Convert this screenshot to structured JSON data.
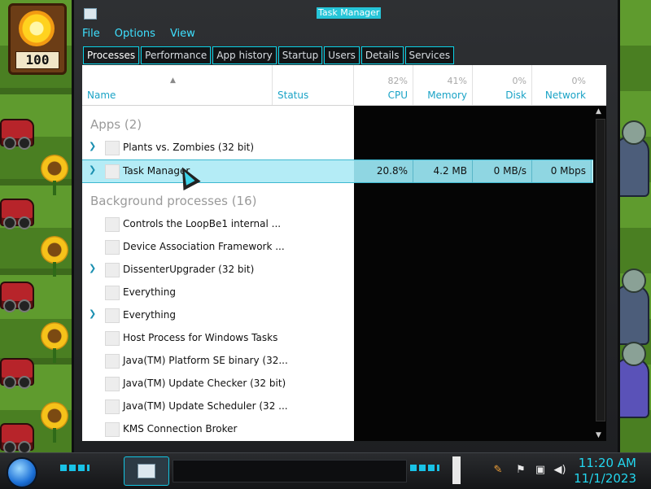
{
  "game": {
    "sun_count": "100"
  },
  "window": {
    "title": "Task Manager",
    "menu": [
      "File",
      "Options",
      "View"
    ],
    "tabs": [
      "Processes",
      "Performance",
      "App history",
      "Startup",
      "Users",
      "Details",
      "Services"
    ],
    "active_tab": "Processes"
  },
  "columns": {
    "name": "Name",
    "status": "Status",
    "cpu": {
      "pct": "82%",
      "label": "CPU"
    },
    "memory": {
      "pct": "41%",
      "label": "Memory"
    },
    "disk": {
      "pct": "0%",
      "label": "Disk"
    },
    "network": {
      "pct": "0%",
      "label": "Network"
    }
  },
  "groups": {
    "apps": "Apps (2)",
    "background": "Background processes (16)"
  },
  "rows": [
    {
      "name": "Plants vs. Zombies (32 bit)",
      "expandable": true
    },
    {
      "name": "Task Manager",
      "expandable": true,
      "selected": true,
      "cpu": "20.8%",
      "memory": "4.2 MB",
      "disk": "0 MB/s",
      "network": "0 Mbps"
    },
    {
      "name": "Controls the LoopBe1 internal ...",
      "expandable": false
    },
    {
      "name": "Device Association Framework ...",
      "expandable": false
    },
    {
      "name": "DissenterUpgrader (32 bit)",
      "expandable": true
    },
    {
      "name": "Everything",
      "expandable": false
    },
    {
      "name": "Everything",
      "expandable": true
    },
    {
      "name": "Host Process for Windows Tasks",
      "expandable": false
    },
    {
      "name": "Java(TM) Platform SE binary (32...",
      "expandable": false
    },
    {
      "name": "Java(TM) Update Checker (32 bit)",
      "expandable": false
    },
    {
      "name": "Java(TM) Update Scheduler (32 ...",
      "expandable": false
    },
    {
      "name": "KMS Connection Broker",
      "expandable": false
    }
  ],
  "taskbar": {
    "time": "11:20 AM",
    "date": "11/1/2023",
    "tray_icons": [
      "app-tray-icon",
      "flag-icon",
      "network-icon",
      "volume-icon"
    ]
  },
  "colors": {
    "accent": "#0bd1e6",
    "selected_row": "#b4ecf6",
    "header_text": "#1aa3c6"
  }
}
